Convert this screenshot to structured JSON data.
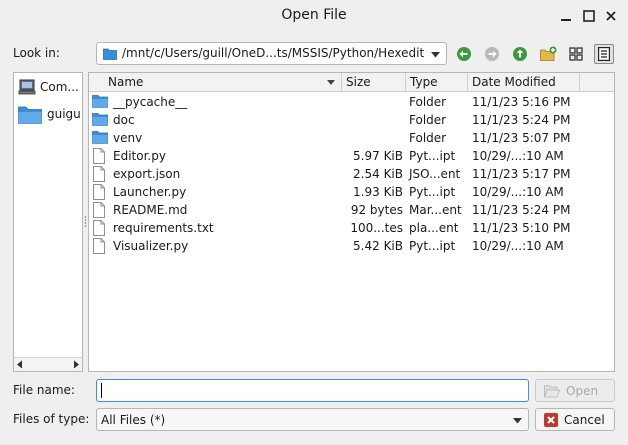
{
  "window": {
    "title": "Open File"
  },
  "look_in": {
    "label": "Look in:",
    "path": "/mnt/c/Users/guill/OneD...ts/MSSIS/Python/Hexedit"
  },
  "sidebar": {
    "items": [
      {
        "label": "Com...",
        "icon": "computer-icon"
      },
      {
        "label": "guigu",
        "icon": "folder-icon"
      }
    ]
  },
  "file_list": {
    "columns": [
      "Name",
      "Size",
      "Type",
      "Date Modified"
    ],
    "rows": [
      {
        "name": "__pycache__",
        "size": "",
        "type": "Folder",
        "date": "11/1/23 5:16 PM",
        "kind": "folder"
      },
      {
        "name": "doc",
        "size": "",
        "type": "Folder",
        "date": "11/1/23 5:24 PM",
        "kind": "folder"
      },
      {
        "name": "venv",
        "size": "",
        "type": "Folder",
        "date": "11/1/23 5:07 PM",
        "kind": "folder"
      },
      {
        "name": "Editor.py",
        "size": "5.97 KiB",
        "type": "Pyt...ipt",
        "date": "10/29/...:10 AM",
        "kind": "file"
      },
      {
        "name": "export.json",
        "size": "2.54 KiB",
        "type": "JSO...ent",
        "date": "11/1/23 5:17 PM",
        "kind": "file"
      },
      {
        "name": "Launcher.py",
        "size": "1.93 KiB",
        "type": "Pyt...ipt",
        "date": "10/29/...:10 AM",
        "kind": "file"
      },
      {
        "name": "README.md",
        "size": "92 bytes",
        "type": "Mar...ent",
        "date": "11/1/23 5:24 PM",
        "kind": "file"
      },
      {
        "name": "requirements.txt",
        "size": "100...tes",
        "type": "pla...ent",
        "date": "11/1/23 5:10 PM",
        "kind": "file"
      },
      {
        "name": "Visualizer.py",
        "size": "5.42 KiB",
        "type": "Pyt...ipt",
        "date": "10/29/...:10 AM",
        "kind": "file"
      }
    ]
  },
  "file_name": {
    "label": "File name:",
    "value": ""
  },
  "file_type": {
    "label": "Files of type:",
    "value": "All Files (*)"
  },
  "buttons": {
    "open": "Open",
    "cancel": "Cancel"
  },
  "colors": {
    "folder": "#3a8fd9",
    "back": "#3c9a3c",
    "up": "#3c9a3c",
    "focus": "#3d8ee0"
  }
}
